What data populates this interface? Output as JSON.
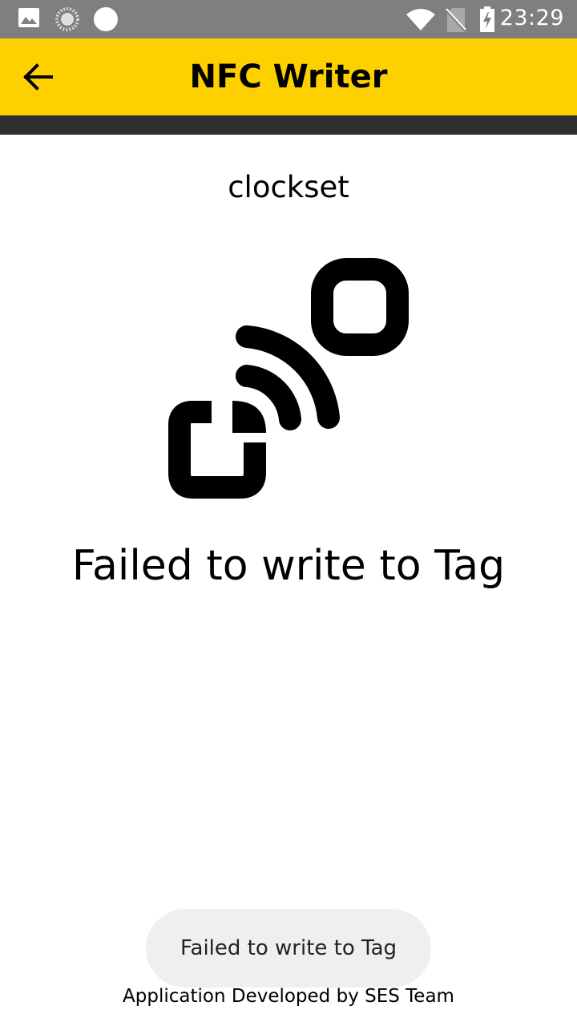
{
  "status_bar": {
    "time": "23:29",
    "left_icons": [
      "image-icon",
      "sync-icon",
      "circle-icon"
    ],
    "right_icons": [
      "wifi-icon",
      "no-sim-icon",
      "battery-charging-icon"
    ]
  },
  "app_bar": {
    "title": "NFC Writer",
    "back_icon": "arrow-back-icon",
    "background_color": "#ffd000"
  },
  "content": {
    "tag_name": "clockset",
    "icon": "nfc-icon",
    "status_message": "Failed to write to Tag"
  },
  "toast": {
    "message": "Failed to write to Tag"
  },
  "footer": {
    "credit": "Application Developed by SES Team"
  }
}
